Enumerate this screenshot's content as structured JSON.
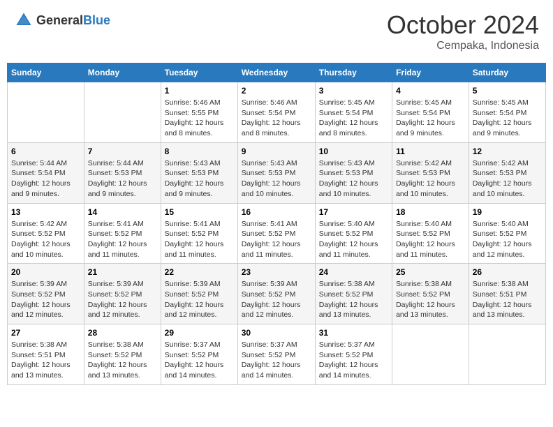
{
  "logo": {
    "text_general": "General",
    "text_blue": "Blue"
  },
  "header": {
    "month": "October 2024",
    "location": "Cempaka, Indonesia"
  },
  "weekdays": [
    "Sunday",
    "Monday",
    "Tuesday",
    "Wednesday",
    "Thursday",
    "Friday",
    "Saturday"
  ],
  "weeks": [
    [
      {
        "day": null
      },
      {
        "day": null
      },
      {
        "day": "1",
        "sunrise": "Sunrise: 5:46 AM",
        "sunset": "Sunset: 5:55 PM",
        "daylight": "Daylight: 12 hours and 8 minutes."
      },
      {
        "day": "2",
        "sunrise": "Sunrise: 5:46 AM",
        "sunset": "Sunset: 5:54 PM",
        "daylight": "Daylight: 12 hours and 8 minutes."
      },
      {
        "day": "3",
        "sunrise": "Sunrise: 5:45 AM",
        "sunset": "Sunset: 5:54 PM",
        "daylight": "Daylight: 12 hours and 8 minutes."
      },
      {
        "day": "4",
        "sunrise": "Sunrise: 5:45 AM",
        "sunset": "Sunset: 5:54 PM",
        "daylight": "Daylight: 12 hours and 9 minutes."
      },
      {
        "day": "5",
        "sunrise": "Sunrise: 5:45 AM",
        "sunset": "Sunset: 5:54 PM",
        "daylight": "Daylight: 12 hours and 9 minutes."
      }
    ],
    [
      {
        "day": "6",
        "sunrise": "Sunrise: 5:44 AM",
        "sunset": "Sunset: 5:54 PM",
        "daylight": "Daylight: 12 hours and 9 minutes."
      },
      {
        "day": "7",
        "sunrise": "Sunrise: 5:44 AM",
        "sunset": "Sunset: 5:53 PM",
        "daylight": "Daylight: 12 hours and 9 minutes."
      },
      {
        "day": "8",
        "sunrise": "Sunrise: 5:43 AM",
        "sunset": "Sunset: 5:53 PM",
        "daylight": "Daylight: 12 hours and 9 minutes."
      },
      {
        "day": "9",
        "sunrise": "Sunrise: 5:43 AM",
        "sunset": "Sunset: 5:53 PM",
        "daylight": "Daylight: 12 hours and 10 minutes."
      },
      {
        "day": "10",
        "sunrise": "Sunrise: 5:43 AM",
        "sunset": "Sunset: 5:53 PM",
        "daylight": "Daylight: 12 hours and 10 minutes."
      },
      {
        "day": "11",
        "sunrise": "Sunrise: 5:42 AM",
        "sunset": "Sunset: 5:53 PM",
        "daylight": "Daylight: 12 hours and 10 minutes."
      },
      {
        "day": "12",
        "sunrise": "Sunrise: 5:42 AM",
        "sunset": "Sunset: 5:53 PM",
        "daylight": "Daylight: 12 hours and 10 minutes."
      }
    ],
    [
      {
        "day": "13",
        "sunrise": "Sunrise: 5:42 AM",
        "sunset": "Sunset: 5:52 PM",
        "daylight": "Daylight: 12 hours and 10 minutes."
      },
      {
        "day": "14",
        "sunrise": "Sunrise: 5:41 AM",
        "sunset": "Sunset: 5:52 PM",
        "daylight": "Daylight: 12 hours and 11 minutes."
      },
      {
        "day": "15",
        "sunrise": "Sunrise: 5:41 AM",
        "sunset": "Sunset: 5:52 PM",
        "daylight": "Daylight: 12 hours and 11 minutes."
      },
      {
        "day": "16",
        "sunrise": "Sunrise: 5:41 AM",
        "sunset": "Sunset: 5:52 PM",
        "daylight": "Daylight: 12 hours and 11 minutes."
      },
      {
        "day": "17",
        "sunrise": "Sunrise: 5:40 AM",
        "sunset": "Sunset: 5:52 PM",
        "daylight": "Daylight: 12 hours and 11 minutes."
      },
      {
        "day": "18",
        "sunrise": "Sunrise: 5:40 AM",
        "sunset": "Sunset: 5:52 PM",
        "daylight": "Daylight: 12 hours and 11 minutes."
      },
      {
        "day": "19",
        "sunrise": "Sunrise: 5:40 AM",
        "sunset": "Sunset: 5:52 PM",
        "daylight": "Daylight: 12 hours and 12 minutes."
      }
    ],
    [
      {
        "day": "20",
        "sunrise": "Sunrise: 5:39 AM",
        "sunset": "Sunset: 5:52 PM",
        "daylight": "Daylight: 12 hours and 12 minutes."
      },
      {
        "day": "21",
        "sunrise": "Sunrise: 5:39 AM",
        "sunset": "Sunset: 5:52 PM",
        "daylight": "Daylight: 12 hours and 12 minutes."
      },
      {
        "day": "22",
        "sunrise": "Sunrise: 5:39 AM",
        "sunset": "Sunset: 5:52 PM",
        "daylight": "Daylight: 12 hours and 12 minutes."
      },
      {
        "day": "23",
        "sunrise": "Sunrise: 5:39 AM",
        "sunset": "Sunset: 5:52 PM",
        "daylight": "Daylight: 12 hours and 12 minutes."
      },
      {
        "day": "24",
        "sunrise": "Sunrise: 5:38 AM",
        "sunset": "Sunset: 5:52 PM",
        "daylight": "Daylight: 12 hours and 13 minutes."
      },
      {
        "day": "25",
        "sunrise": "Sunrise: 5:38 AM",
        "sunset": "Sunset: 5:52 PM",
        "daylight": "Daylight: 12 hours and 13 minutes."
      },
      {
        "day": "26",
        "sunrise": "Sunrise: 5:38 AM",
        "sunset": "Sunset: 5:51 PM",
        "daylight": "Daylight: 12 hours and 13 minutes."
      }
    ],
    [
      {
        "day": "27",
        "sunrise": "Sunrise: 5:38 AM",
        "sunset": "Sunset: 5:51 PM",
        "daylight": "Daylight: 12 hours and 13 minutes."
      },
      {
        "day": "28",
        "sunrise": "Sunrise: 5:38 AM",
        "sunset": "Sunset: 5:52 PM",
        "daylight": "Daylight: 12 hours and 13 minutes."
      },
      {
        "day": "29",
        "sunrise": "Sunrise: 5:37 AM",
        "sunset": "Sunset: 5:52 PM",
        "daylight": "Daylight: 12 hours and 14 minutes."
      },
      {
        "day": "30",
        "sunrise": "Sunrise: 5:37 AM",
        "sunset": "Sunset: 5:52 PM",
        "daylight": "Daylight: 12 hours and 14 minutes."
      },
      {
        "day": "31",
        "sunrise": "Sunrise: 5:37 AM",
        "sunset": "Sunset: 5:52 PM",
        "daylight": "Daylight: 12 hours and 14 minutes."
      },
      {
        "day": null
      },
      {
        "day": null
      }
    ]
  ]
}
